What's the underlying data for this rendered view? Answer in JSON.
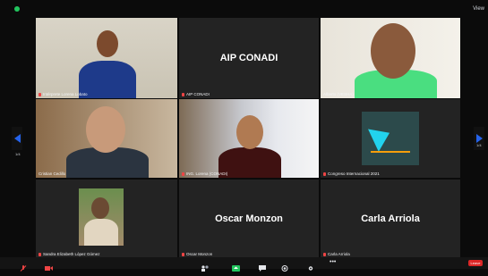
{
  "window": {
    "view_label": "View"
  },
  "participants": [
    {
      "name": "Intérprete Lorena Lobato",
      "display": ""
    },
    {
      "name": "AIP CONADI",
      "display": "AIP CONADI"
    },
    {
      "name": "Alberto (VESHA)",
      "display": ""
    },
    {
      "name": "Cristian Cedillo",
      "display": ""
    },
    {
      "name": "ING. Lorena (CONADI)",
      "display": ""
    },
    {
      "name": "Congreso Internacional 2021",
      "display": ""
    },
    {
      "name": "Sandra Elizabeth López Gómez",
      "display": ""
    },
    {
      "name": "Oscar Monzon",
      "display": "Oscar Monzon"
    },
    {
      "name": "Carla Arriola",
      "display": "Carla Arriola"
    }
  ],
  "pagination": {
    "left_label": "1/4",
    "right_label": "1/4"
  },
  "toolbar": {
    "leave_label": "Leave"
  },
  "colors": {
    "active_speaker": "#e8e65a",
    "leave": "#dc2626",
    "nav_arrow": "#2563eb"
  }
}
